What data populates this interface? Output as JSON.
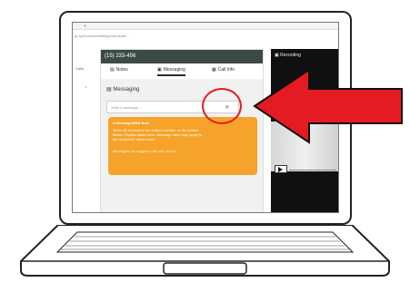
{
  "browser": {
    "tab_label": "+",
    "url_text": "gl.xyz/home#/settings/call-audit/..."
  },
  "left_stub": {
    "item1": "Calls",
    "item2": "•"
  },
  "call_panel": {
    "header_number": "(15) 233-456",
    "tabs": [
      {
        "label": "Notes",
        "active": false
      },
      {
        "label": "Messaging",
        "active": true
      },
      {
        "label": "Call Info",
        "active": false
      }
    ],
    "messaging_title": "Messaging",
    "input_placeholder": "Write a message...",
    "notice": {
      "title": "Message/SMS Note",
      "lines": [
        "Texts will be sent to the caller’s number on file shown",
        "above. Replies show here. Message rates may apply to",
        "the recipient’s carrier plan."
      ],
      "footnote": "Messages are logged in the call record."
    }
  },
  "video_panel": {
    "title": "Recording"
  },
  "colors": {
    "header_bg": "#3c4a46",
    "notice_bg": "#f5a32a",
    "callout_red": "#e41b23"
  }
}
